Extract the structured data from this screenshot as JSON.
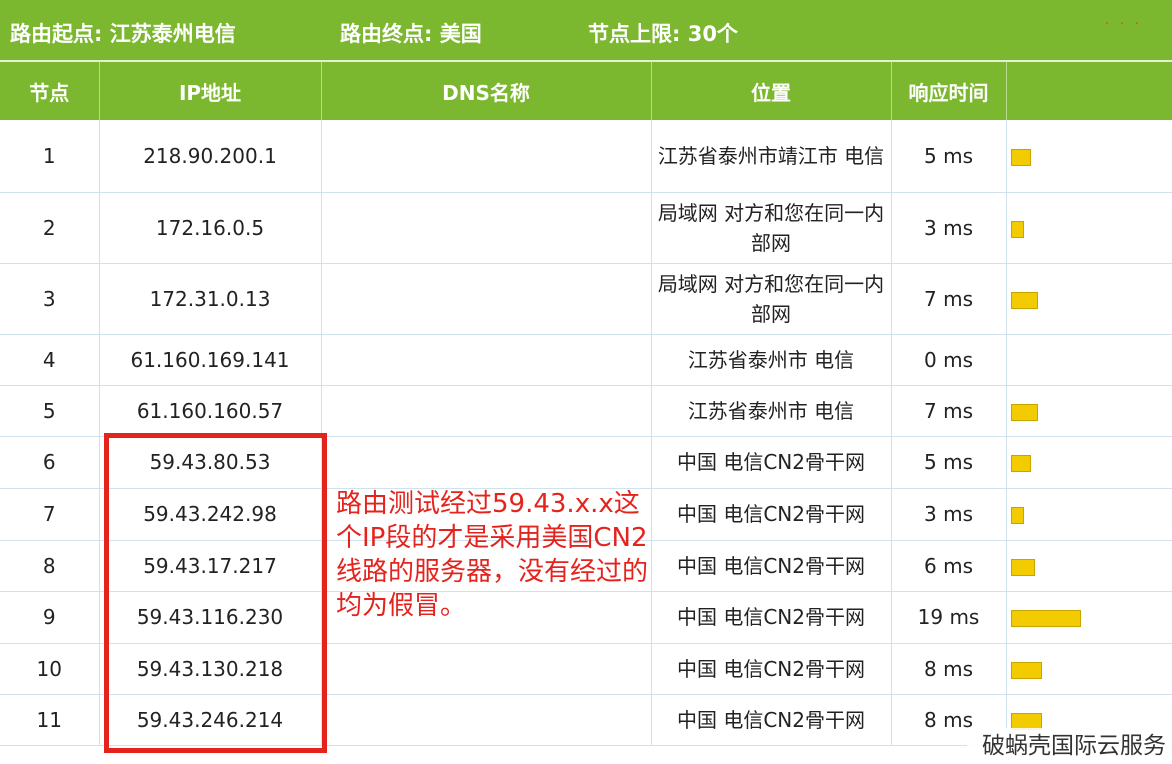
{
  "header": {
    "start_label": "路由起点: 江苏泰州电信",
    "end_label": "路由终点: 美国",
    "limit_label": "节点上限: 30个"
  },
  "table": {
    "columns": [
      "节点",
      "IP地址",
      "DNS名称",
      "位置",
      "响应时间",
      ""
    ],
    "rows": [
      {
        "hop": "1",
        "ip": "218.90.200.1",
        "dns": "",
        "location": "江苏省泰州市靖江市 电信",
        "time": "5 ms",
        "bar": 5
      },
      {
        "hop": "2",
        "ip": "172.16.0.5",
        "dns": "",
        "location": "局域网 对方和您在同一内部网",
        "time": "3 ms",
        "bar": 3
      },
      {
        "hop": "3",
        "ip": "172.31.0.13",
        "dns": "",
        "location": "局域网 对方和您在同一内部网",
        "time": "7 ms",
        "bar": 7
      },
      {
        "hop": "4",
        "ip": "61.160.169.141",
        "dns": "",
        "location": "江苏省泰州市 电信",
        "time": "0 ms",
        "bar": 0
      },
      {
        "hop": "5",
        "ip": "61.160.160.57",
        "dns": "",
        "location": "江苏省泰州市 电信",
        "time": "7 ms",
        "bar": 7
      },
      {
        "hop": "6",
        "ip": "59.43.80.53",
        "dns": "",
        "location": "中国 电信CN2骨干网",
        "time": "5 ms",
        "bar": 5
      },
      {
        "hop": "7",
        "ip": "59.43.242.98",
        "dns": "",
        "location": "中国 电信CN2骨干网",
        "time": "3 ms",
        "bar": 3
      },
      {
        "hop": "8",
        "ip": "59.43.17.217",
        "dns": "",
        "location": "中国 电信CN2骨干网",
        "time": "6 ms",
        "bar": 6
      },
      {
        "hop": "9",
        "ip": "59.43.116.230",
        "dns": "",
        "location": "中国 电信CN2骨干网",
        "time": "19 ms",
        "bar": 19
      },
      {
        "hop": "10",
        "ip": "59.43.130.218",
        "dns": "",
        "location": "中国 电信CN2骨干网",
        "time": "8 ms",
        "bar": 8
      },
      {
        "hop": "11",
        "ip": "59.43.246.214",
        "dns": "",
        "location": "中国 电信CN2骨干网",
        "time": "8 ms",
        "bar": 8
      }
    ]
  },
  "annotation": {
    "text": "路由测试经过59.43.x.x这个IP段的才是采用美国CN2线路的服务器，没有经过的均为假冒。"
  },
  "watermark": "破蜗壳国际云服务",
  "colors": {
    "header_green": "#7cb82f",
    "bar_yellow": "#f2cc00",
    "annotation_red": "#e5231d"
  }
}
